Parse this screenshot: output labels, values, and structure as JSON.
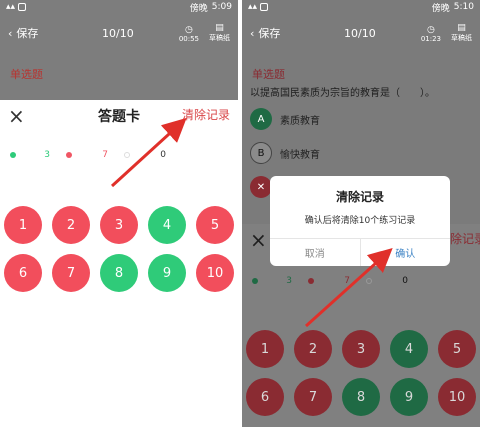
{
  "statusbar": {
    "carrier": "傍晚",
    "left_time": "5:09",
    "right_time": "5:10"
  },
  "header": {
    "back_label": "保存",
    "progress": "10/10",
    "timer_left": "00:55",
    "timer_right": "01:23",
    "draft_label": "草稿纸"
  },
  "question": {
    "type_label": "单选题",
    "text": "以提高国民素质为宗旨的教育是（　　）。",
    "options": [
      {
        "key": "A",
        "text": "素质教育"
      },
      {
        "key": "B",
        "text": "愉快教育"
      },
      {
        "key": "",
        "text": ""
      }
    ]
  },
  "sheet": {
    "title": "答题卡",
    "clear_label": "清除记录",
    "legend": {
      "correct": "3",
      "wrong": "7",
      "unanswered": "0"
    },
    "items": [
      {
        "n": "1",
        "status": "wrong"
      },
      {
        "n": "2",
        "status": "wrong"
      },
      {
        "n": "3",
        "status": "wrong"
      },
      {
        "n": "4",
        "status": "correct"
      },
      {
        "n": "5",
        "status": "wrong"
      },
      {
        "n": "6",
        "status": "wrong"
      },
      {
        "n": "7",
        "status": "wrong"
      },
      {
        "n": "8",
        "status": "correct"
      },
      {
        "n": "9",
        "status": "correct"
      },
      {
        "n": "10",
        "status": "wrong"
      }
    ]
  },
  "dialog": {
    "title": "清除记录",
    "message": "确认后将清除10个练习记录",
    "cancel": "取消",
    "confirm": "确认"
  },
  "colors": {
    "accent_red": "#d94648",
    "correct_green": "#2ecb7a",
    "wrong_red": "#f24e5c",
    "arrow": "#e0302a"
  }
}
